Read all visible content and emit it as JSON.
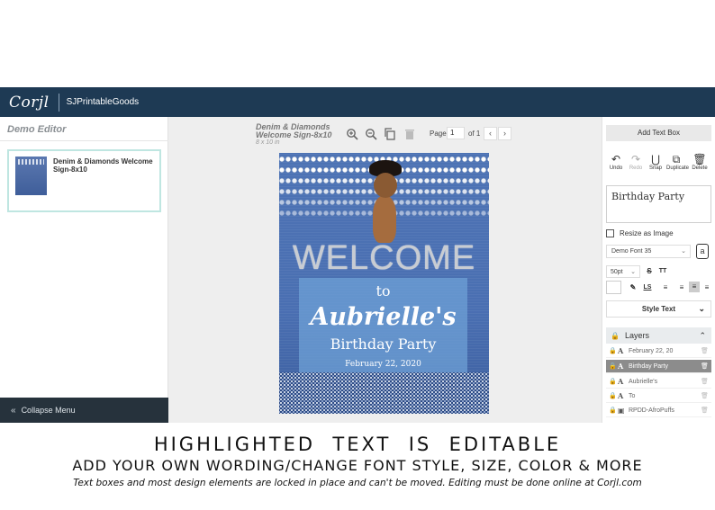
{
  "header": {
    "logo": "Corjl",
    "shop_name": "SJPrintableGoods"
  },
  "left_panel": {
    "title": "Demo Editor",
    "template_name": "Denim & Diamonds Welcome Sign-8x10",
    "collapse_label": "Collapse Menu"
  },
  "canvas": {
    "doc_title": "Denim & Diamonds Welcome Sign-8x10",
    "doc_size": "8 x 10 in",
    "page_label": "Page",
    "page_value": "1",
    "page_of": "of 1",
    "design": {
      "welcome": "WELCOME",
      "to": "to",
      "name": "Aubrielle's",
      "event": "Birthday Party",
      "date": "February 22, 2020"
    }
  },
  "right_panel": {
    "add_text_box": "Add Text Box",
    "actions": [
      {
        "icon": "undo-icon",
        "label": "Undo"
      },
      {
        "icon": "redo-icon",
        "label": "Redo"
      },
      {
        "icon": "snap-icon",
        "label": "Snap"
      },
      {
        "icon": "duplicate-icon",
        "label": "Duplicate"
      },
      {
        "icon": "delete-icon",
        "label": "Delete"
      }
    ],
    "text_value": "Birthday Party",
    "resize_label": "Resize as Image",
    "font": "Demo Font 35",
    "font_size": "50pt",
    "style_text": "Style Text",
    "layers_title": "Layers",
    "layers": [
      {
        "type": "text",
        "name": "February 22, 20"
      },
      {
        "type": "text",
        "name": "Birthday Party"
      },
      {
        "type": "text",
        "name": "Aubrielle's"
      },
      {
        "type": "text",
        "name": "To"
      },
      {
        "type": "image",
        "name": "RPDD-AfroPuffs"
      }
    ]
  },
  "captions": {
    "line1": "HIGHLIGHTED  TEXT  IS  EDITABLE",
    "line2": "ADD YOUR OWN WORDING/CHANGE FONT STYLE, SIZE, COLOR & MORE",
    "line3": "Text boxes and most design elements are locked in place and can't be moved. Editing must be done online at Corjl.com"
  }
}
